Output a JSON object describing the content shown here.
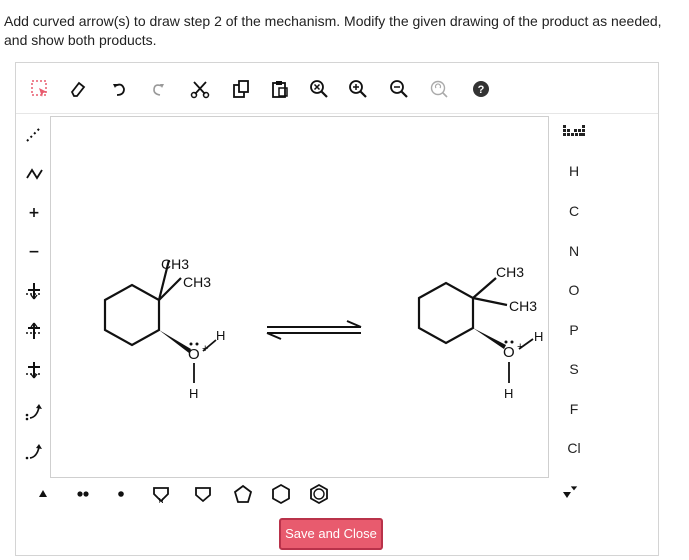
{
  "instructions": "Add curved arrow(s) to draw step 2 of the mechanism. Modify the given drawing of the product as needed, and show both products.",
  "top_toolbar": {
    "icons": [
      "select-icon",
      "eraser-icon",
      "undo-icon",
      "redo-icon",
      "cut-icon",
      "copy-icon",
      "paste-icon",
      "zoom-fit-icon",
      "zoom-in-icon",
      "zoom-out-icon",
      "clean-icon",
      "help-icon"
    ]
  },
  "left_toolbar": {
    "tools": [
      {
        "name": "dotted-bond-icon"
      },
      {
        "name": "chain-icon"
      },
      {
        "name": "positive-charge-icon",
        "label": "+"
      },
      {
        "name": "negative-charge-icon",
        "label": "−"
      },
      {
        "name": "add-lone-pair-icon"
      },
      {
        "name": "remove-lone-pair-icon"
      },
      {
        "name": "radical-charge-icon"
      },
      {
        "name": "curved-arrow-pair-icon"
      },
      {
        "name": "curved-arrow-single-icon"
      }
    ]
  },
  "right_toolbar": {
    "periodic_table_icon": "periodic-table-icon",
    "elements": [
      "H",
      "C",
      "N",
      "O",
      "P",
      "S",
      "F",
      "Cl"
    ]
  },
  "bottom_toolbar": {
    "icons": [
      "expand-left-icon",
      "lone-pair-icon",
      "radical-icon",
      "pyrrole-icon",
      "cyclobutane-icon",
      "cyclopentane-icon",
      "cyclohexane-icon",
      "benzene-icon",
      "expand-right-icon"
    ]
  },
  "canvas": {
    "left_molecule": {
      "labels": {
        "ch3_top": "CH3",
        "ch3_side": "CH3",
        "oxygen": "O",
        "charge": "+",
        "h_right": "H",
        "h_bottom": "H"
      }
    },
    "right_molecule": {
      "labels": {
        "ch3_top": "CH3",
        "ch3_side": "CH3",
        "oxygen": "O",
        "charge": "+",
        "h_right": "H",
        "h_bottom": "H"
      }
    }
  },
  "save_button": {
    "label": "Save and Close"
  },
  "colors": {
    "accent": "#e85b6e",
    "accent_border": "#b9324a",
    "help": "#333333"
  }
}
